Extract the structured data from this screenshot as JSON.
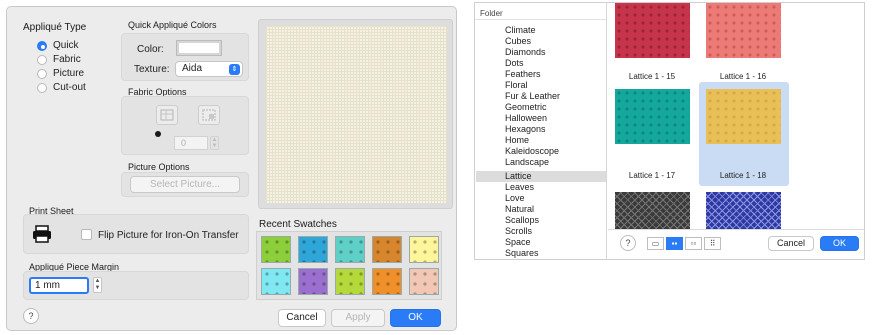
{
  "applique_type": {
    "title": "Appliqué Type",
    "options": [
      "Quick",
      "Fabric",
      "Picture",
      "Cut-out"
    ],
    "selected": "Quick"
  },
  "quick_colors": {
    "title": "Quick Appliqué Colors",
    "color_label": "Color:",
    "texture_label": "Texture:",
    "texture_value": "Aida"
  },
  "fabric_options": {
    "title": "Fabric Options",
    "rotation_value": "0"
  },
  "picture_options": {
    "title": "Picture Options",
    "select_button": "Select Picture..."
  },
  "print_sheet": {
    "title": "Print Sheet",
    "flip_label": "Flip Picture for Iron-On Transfer"
  },
  "recent_swatches": {
    "title": "Recent Swatches",
    "colors": [
      "#8ccf3a",
      "#2fa6d8",
      "#5fd0c8",
      "#d8862e",
      "#fff59a",
      "#7fe8f2",
      "#9a6fd0",
      "#b5d83a",
      "#f0902a",
      "#f2c8b4"
    ]
  },
  "margin": {
    "title": "Appliqué Piece Margin",
    "value": "1 mm"
  },
  "buttons": {
    "help": "?",
    "cancel": "Cancel",
    "apply": "Apply",
    "ok": "OK"
  },
  "folder_panel": {
    "header": "Folder",
    "items": [
      "Climate",
      "Cubes",
      "Diamonds",
      "Dots",
      "Feathers",
      "Floral",
      "Fur & Leather",
      "Geometric",
      "Halloween",
      "Hexagons",
      "Home",
      "Kaleidoscope",
      "Landscape",
      "Lattice",
      "Leaves",
      "Love",
      "Natural",
      "Scallops",
      "Scrolls",
      "Space",
      "Squares"
    ],
    "selected": "Lattice"
  },
  "swatch_grid": {
    "tiles": [
      {
        "label": "Lattice 1 - 15",
        "color": "#c8344b"
      },
      {
        "label": "Lattice 1 - 16",
        "color": "#ec7b78"
      },
      {
        "label": "Lattice 1 - 17",
        "color": "#14a89c"
      },
      {
        "label": "Lattice 1 - 18",
        "color": "#e9bf58"
      },
      {
        "label": "",
        "color": "#3a3a3a"
      },
      {
        "label": "",
        "color": "#2f3aa0"
      }
    ],
    "selected": "Lattice 1 - 18"
  },
  "right_buttons": {
    "help": "?",
    "cancel": "Cancel",
    "ok": "OK"
  },
  "accent_color": "#2a7cf6"
}
